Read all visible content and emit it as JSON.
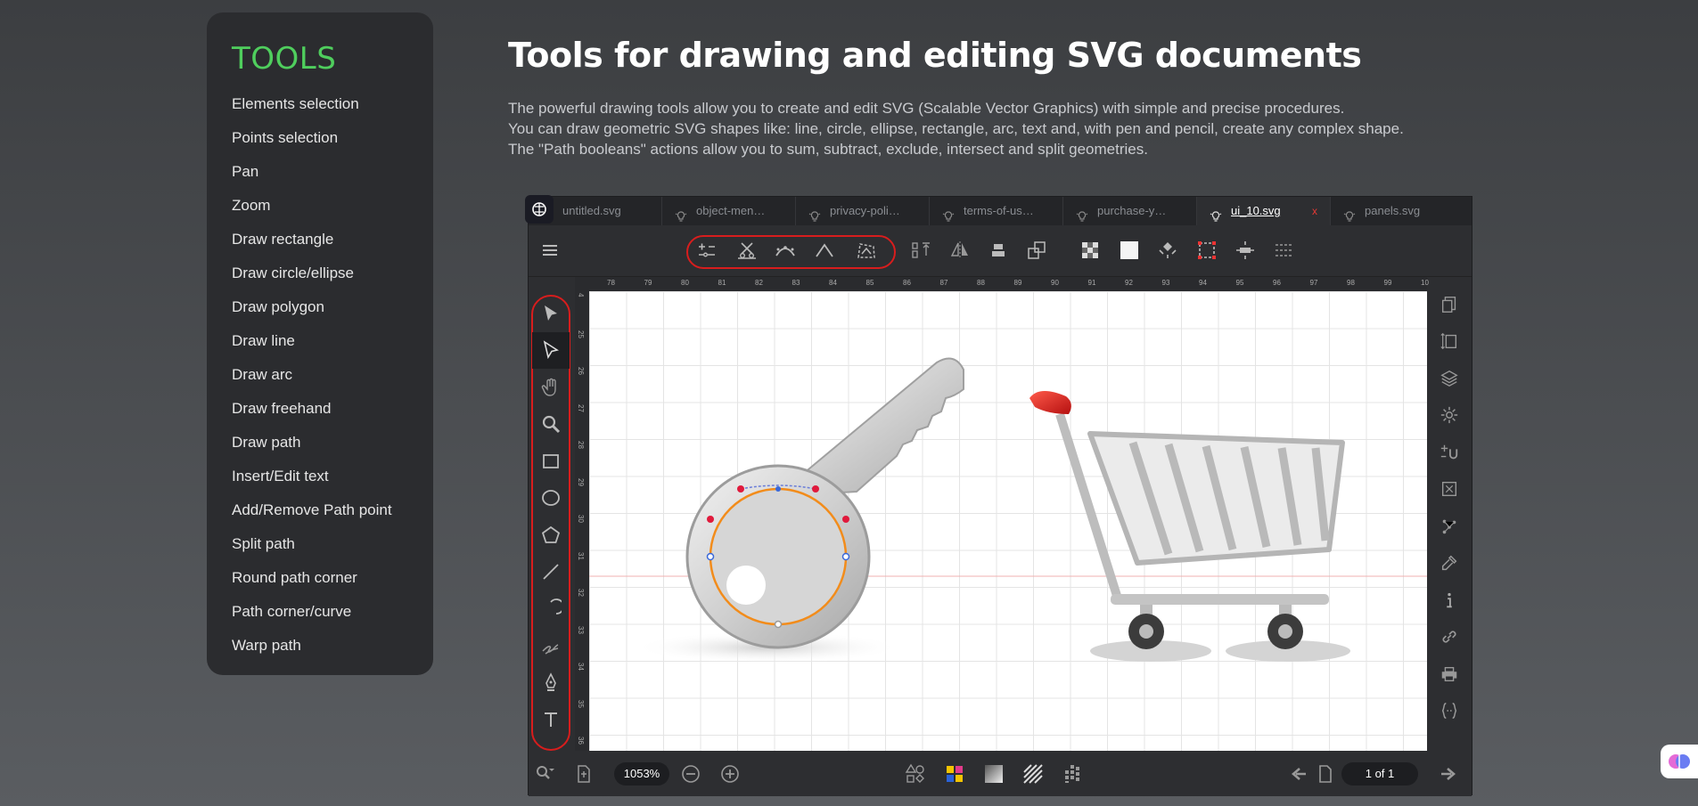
{
  "sidebar": {
    "title": "TOOLS",
    "items": [
      {
        "label": "Elements selection"
      },
      {
        "label": "Points selection"
      },
      {
        "label": "Pan"
      },
      {
        "label": "Zoom"
      },
      {
        "label": "Draw rectangle"
      },
      {
        "label": "Draw circle/ellipse"
      },
      {
        "label": "Draw polygon"
      },
      {
        "label": "Draw line"
      },
      {
        "label": "Draw arc"
      },
      {
        "label": "Draw freehand"
      },
      {
        "label": "Draw path"
      },
      {
        "label": "Insert/Edit text"
      },
      {
        "label": "Add/Remove Path point"
      },
      {
        "label": "Split path"
      },
      {
        "label": "Round path corner"
      },
      {
        "label": "Path corner/curve"
      },
      {
        "label": "Warp path"
      }
    ]
  },
  "main": {
    "heading": "Tools for drawing and editing SVG documents",
    "description": [
      "The powerful drawing tools allow you to create and edit SVG (Scalable Vector Graphics) with simple and precise procedures.",
      "You can draw geometric SVG shapes like: line, circle, ellipse, rectangle, arc, text and, with pen and pencil, create any complex shape.",
      "The \"Path booleans\" actions allow you to sum, subtract, exclude, intersect and split geometries."
    ]
  },
  "editor": {
    "tabs": [
      {
        "label": "untitled.svg",
        "active": false
      },
      {
        "label": "object-men…",
        "active": false
      },
      {
        "label": "privacy-poli…",
        "active": false
      },
      {
        "label": "terms-of-us…",
        "active": false
      },
      {
        "label": "purchase-y…",
        "active": false
      },
      {
        "label": "ui_10.svg",
        "active": true,
        "close": "x"
      },
      {
        "label": "panels.svg",
        "active": false
      }
    ],
    "ruler_top_labels": [
      "78",
      "79",
      "80",
      "81",
      "82",
      "83",
      "84",
      "85",
      "86",
      "87",
      "88",
      "89",
      "90",
      "91",
      "92",
      "93",
      "94",
      "95",
      "96",
      "97",
      "98",
      "99",
      "10"
    ],
    "ruler_left_labels": [
      "4",
      "25",
      "26",
      "27",
      "28",
      "29",
      "30",
      "31",
      "32",
      "33",
      "34",
      "35",
      "36"
    ],
    "zoom_level": "1053%",
    "page_indicator": "1 of 1",
    "colors": {
      "accent_red": "#d81d1d",
      "tools_green": "#4fce5d",
      "selection_orange": "#f28c1b"
    }
  }
}
